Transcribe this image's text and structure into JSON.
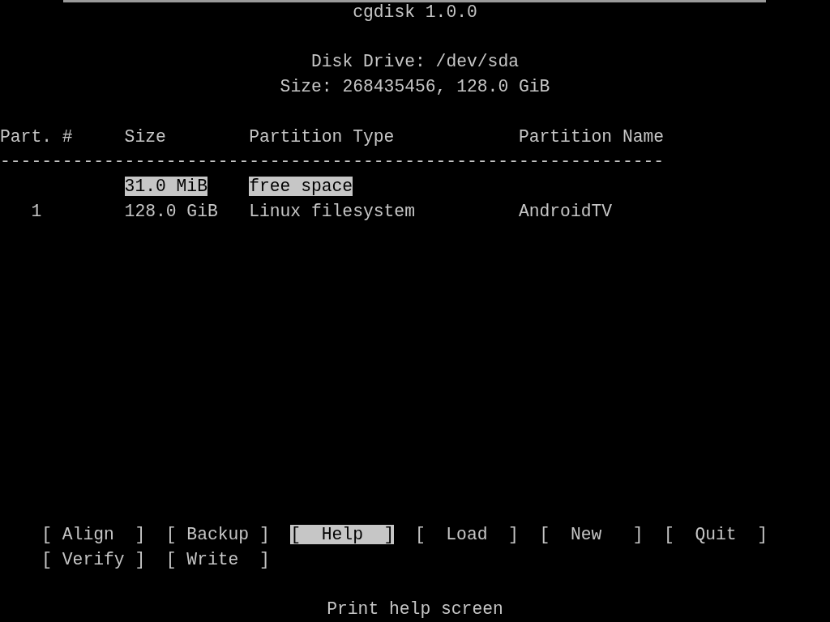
{
  "title": "cgdisk 1.0.0",
  "disk_drive": "Disk Drive: /dev/sda",
  "size": "Size: 268435456, 128.0 GiB",
  "table": {
    "columns": [
      "Part. #",
      "Size",
      "Partition Type",
      "Partition Name"
    ],
    "divider": "----------------------------------------------------------------",
    "rows": [
      {
        "part": "",
        "size": "31.0 MiB",
        "type": "free space",
        "name": "",
        "selected": true
      },
      {
        "part": "1",
        "size": "128.0 GiB",
        "type": "Linux filesystem",
        "name": "AndroidTV",
        "selected": false
      }
    ]
  },
  "buttons": [
    {
      "label": "[ Align  ]",
      "selected": false
    },
    {
      "label": "[ Backup ]",
      "selected": false
    },
    {
      "label": "[  Help  ]",
      "selected": true
    },
    {
      "label": "[  Load  ]",
      "selected": false
    },
    {
      "label": "[  New   ]",
      "selected": false
    },
    {
      "label": "[  Quit  ]",
      "selected": false
    },
    {
      "label": "[ Verify ]",
      "selected": false
    },
    {
      "label": "[ Write  ]",
      "selected": false
    }
  ],
  "status_bar": "Print help screen"
}
